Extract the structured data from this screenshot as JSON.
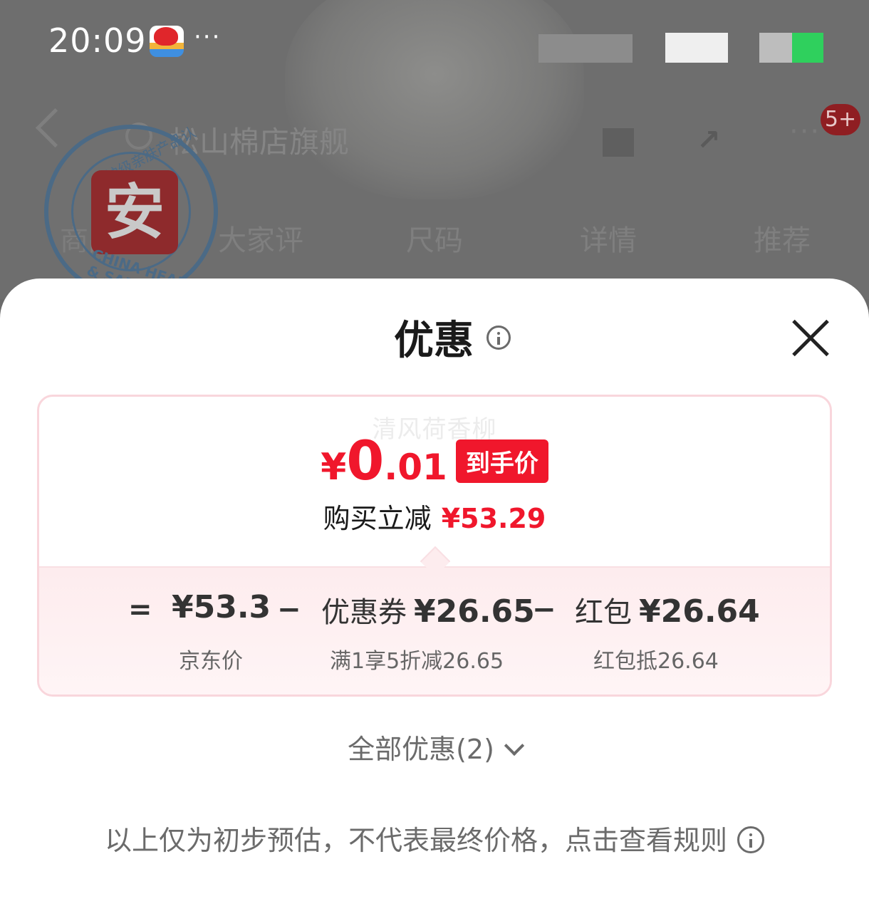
{
  "status_bar": {
    "time": "20:09",
    "more": "···"
  },
  "nav": {
    "search_text": "松山棉店旗舰",
    "badge": "5+",
    "share_icon": "share-icon",
    "more": "···"
  },
  "tabs": [
    "商品",
    "大家评",
    "尺码",
    "详情",
    "推荐"
  ],
  "seal": {
    "center_char": "安",
    "top_text": "医护级亲肤产品认证",
    "bottom_text": "CHINA HEALTH & SAFETY"
  },
  "sheet": {
    "title": "优惠",
    "watermark": "清风荷香柳",
    "final_price": {
      "yen": "¥",
      "integer": "0",
      "decimal": ".01",
      "tag": "到手价"
    },
    "reduce": {
      "label": "购买立减",
      "amount": "¥53.29"
    },
    "breakdown": {
      "eq": "=",
      "minus": "−",
      "jd_price": "¥53.3",
      "jd_price_label": "京东价",
      "coupon_label": "优惠券",
      "coupon_value": "¥26.65",
      "coupon_sub": "满1享5折减26.65",
      "redpacket_label": "红包",
      "redpacket_value": "¥26.64",
      "redpacket_sub": "红包抵26.64"
    },
    "all_offers": "全部优惠(2)",
    "disclaimer": "以上仅为初步预估，不代表最终价格，点击查看规则"
  },
  "colors": {
    "accent_red": "#f0172c",
    "card_border": "#f9d6dc",
    "battery_green": "#2fd05d"
  }
}
